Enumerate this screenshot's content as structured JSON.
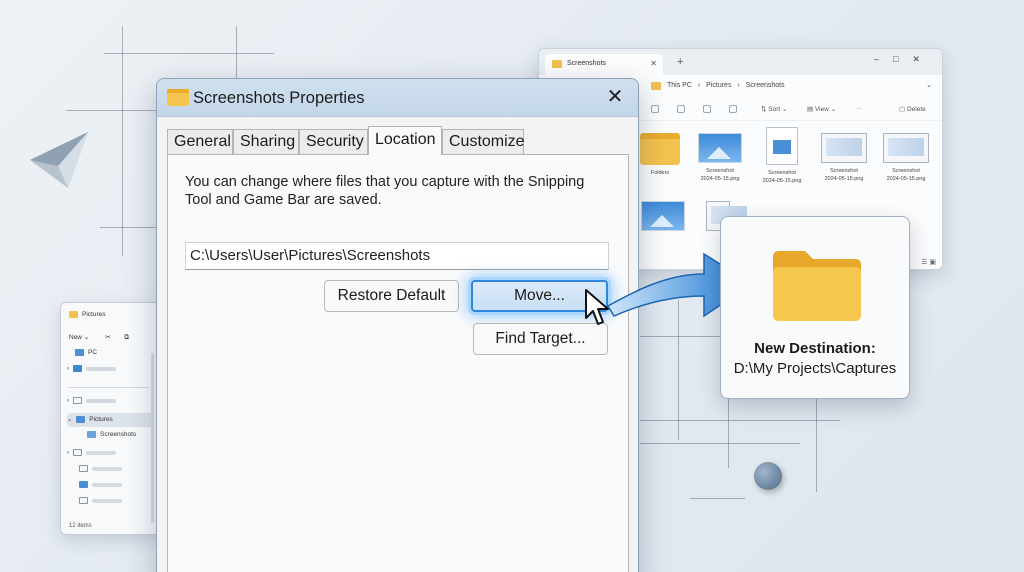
{
  "dialog": {
    "title": "Screenshots Properties",
    "close_glyph": "✕",
    "tabs": [
      {
        "label": "General"
      },
      {
        "label": "Sharing"
      },
      {
        "label": "Security"
      },
      {
        "label": "Location",
        "active": true
      },
      {
        "label": "Customize"
      }
    ],
    "description": "You can change where files that you capture with the Snipping Tool and Game Bar are saved.",
    "path_value": "C:\\Users\\User\\Pictures\\Screenshots",
    "restore_default_label": "Restore Default",
    "move_label": "Move...",
    "find_target_label": "Find Target..."
  },
  "destination": {
    "title": "New Destination:",
    "path": "D:\\My Projects\\Captures"
  },
  "explorer_right": {
    "tab_title": "Screenshots",
    "breadcrumb": [
      "This PC",
      "Pictures",
      "Screenshots"
    ],
    "breadcrumb_sep": "›",
    "toolbar": {
      "sort": "Sort",
      "view": "View",
      "delete": "Delete"
    },
    "items": [
      {
        "type": "folder",
        "label": "Folders",
        "sub": ""
      },
      {
        "type": "img",
        "label": "Screenshot",
        "sub": "2024-05-15.png"
      },
      {
        "type": "doc",
        "label": "Screenshot",
        "sub": "2024-05-15.png"
      },
      {
        "type": "shot",
        "label": "Screenshot",
        "sub": "2024-05-15.png"
      },
      {
        "type": "shot",
        "label": "Screenshot",
        "sub": "2024-05-15.png"
      }
    ]
  },
  "explorer_left": {
    "title": "Pictures",
    "new_label": "New",
    "nav": [
      {
        "label": "PC"
      },
      {
        "label": "Pictures"
      },
      {
        "label": "Screenshots"
      }
    ],
    "status": "12 items"
  },
  "colors": {
    "accent": "#2f86dd",
    "folder": "#f5c64f",
    "titlebar": "#c7dbee"
  }
}
